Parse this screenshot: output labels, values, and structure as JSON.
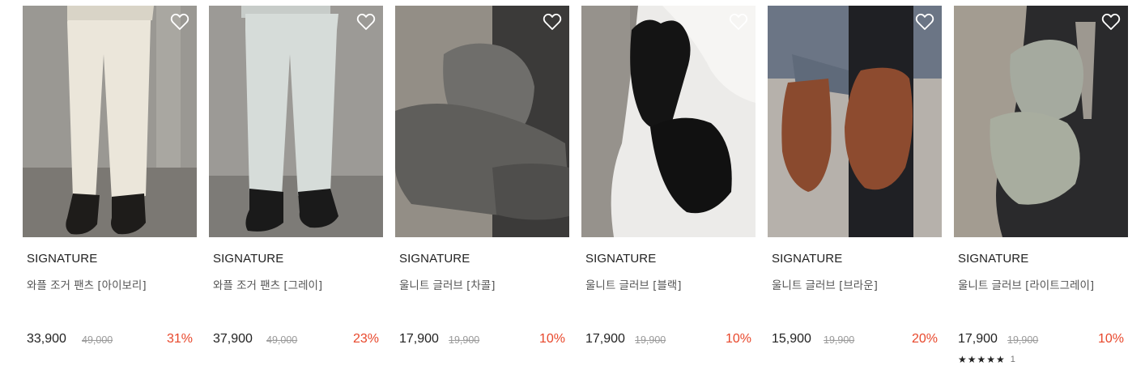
{
  "products": [
    {
      "brand": "SIGNATURE",
      "name": "와플 조거 팬츠 [아이보리]",
      "price": "33,900",
      "original_price": "49,000",
      "discount": "31%",
      "image": "ivory-waffle-jogger-pants",
      "wishlist_icon": "heart-outline-icon"
    },
    {
      "brand": "SIGNATURE",
      "name": "와플 조거 팬츠 [그레이]",
      "price": "37,900",
      "original_price": "49,000",
      "discount": "23%",
      "image": "gray-waffle-jogger-pants",
      "wishlist_icon": "heart-outline-icon"
    },
    {
      "brand": "SIGNATURE",
      "name": "울니트 글러브 [차콜]",
      "price": "17,900",
      "original_price": "19,900",
      "discount": "10%",
      "image": "charcoal-wool-knit-gloves",
      "wishlist_icon": "heart-outline-icon"
    },
    {
      "brand": "SIGNATURE",
      "name": "울니트 글러브 [블랙]",
      "price": "17,900",
      "original_price": "19,900",
      "discount": "10%",
      "image": "black-wool-knit-gloves",
      "wishlist_icon": "heart-outline-icon"
    },
    {
      "brand": "SIGNATURE",
      "name": "울니트 글러브 [브라운]",
      "price": "15,900",
      "original_price": "19,900",
      "discount": "20%",
      "image": "brown-wool-knit-gloves",
      "wishlist_icon": "heart-outline-icon"
    },
    {
      "brand": "SIGNATURE",
      "name": "울니트 글러브 [라이트그레이]",
      "price": "17,900",
      "original_price": "19,900",
      "discount": "10%",
      "image": "light-gray-wool-knit-gloves",
      "wishlist_icon": "heart-outline-icon",
      "rating": {
        "stars": "★★★★★",
        "count": "1"
      }
    }
  ],
  "colors": {
    "discount": "#e8472b",
    "text": "#222222",
    "muted": "#9a9a9a"
  }
}
